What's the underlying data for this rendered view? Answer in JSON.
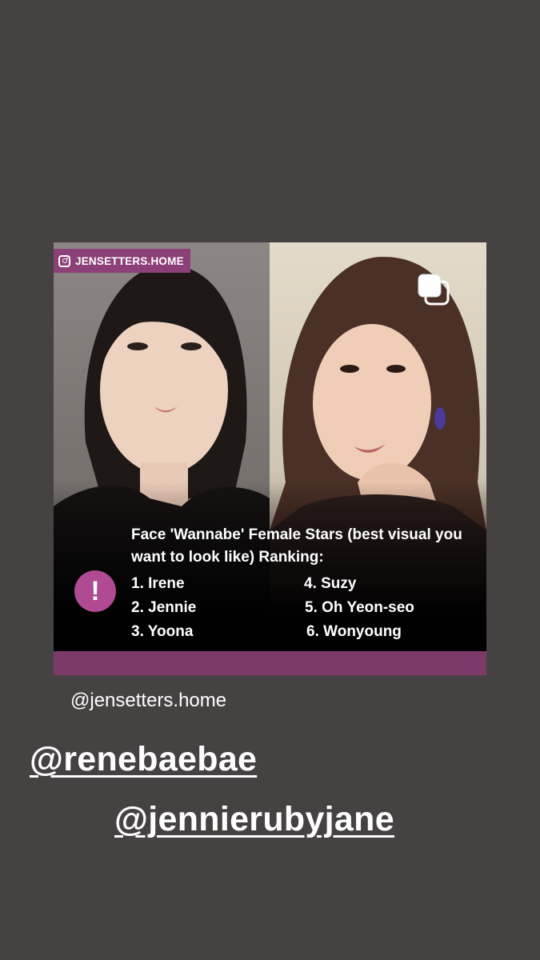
{
  "post": {
    "badge": {
      "icon": "instagram-icon",
      "text": "JENSETTERS.HOME"
    },
    "gallery_icon": "multiple-images-icon",
    "alert_icon": {
      "name": "exclamation-icon",
      "glyph": "!"
    },
    "headline": "Face 'Wannabe' Female Stars (best visual you want to look like) Ranking:",
    "ranking": [
      "1. Irene",
      "2. Jennie",
      "3. Yoona",
      "4. Suzy",
      "5. Oh Yeon-seo",
      "6. Wonyoung"
    ],
    "colors": {
      "accent": "#8d3f78",
      "bar": "#7c3a6a",
      "alert": "#b04a92"
    }
  },
  "story": {
    "credit": "@jensetters.home",
    "mentions": [
      "@renebaebae",
      "@jennierubyjane"
    ],
    "background": "#474242"
  }
}
